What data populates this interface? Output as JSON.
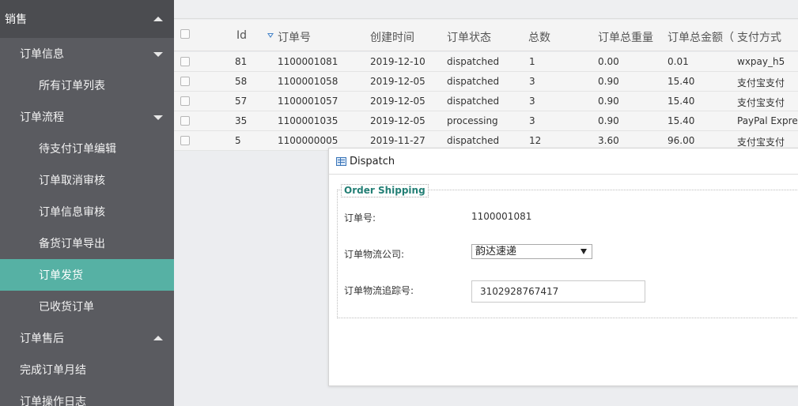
{
  "sidebar": {
    "section": "销售",
    "items": [
      {
        "label": "订单信息",
        "level": 1,
        "caret": "down"
      },
      {
        "label": "所有订单列表",
        "level": 2
      },
      {
        "label": "订单流程",
        "level": 1,
        "caret": "down"
      },
      {
        "label": "待支付订单编辑",
        "level": 2
      },
      {
        "label": "订单取消审核",
        "level": 2
      },
      {
        "label": "订单信息审核",
        "level": 2
      },
      {
        "label": "备货订单导出",
        "level": 2
      },
      {
        "label": "订单发货",
        "level": 2,
        "active": true
      },
      {
        "label": "已收货订单",
        "level": 2
      },
      {
        "label": "订单售后",
        "level": 1,
        "caret": "up"
      },
      {
        "label": "完成订单月结",
        "level": 1
      },
      {
        "label": "订单操作日志",
        "level": 1
      }
    ]
  },
  "table": {
    "headers": {
      "id": "Id",
      "order_no": "订单号",
      "created": "创建时间",
      "status": "订单状态",
      "total": "总数",
      "weight": "订单总重量",
      "amount": "订单总金额（",
      "payment": "支付方式"
    },
    "rows": [
      {
        "id": "81",
        "order_no": "1100001081",
        "created": "2019-12-10",
        "status": "dispatched",
        "total": "1",
        "weight": "0.00",
        "amount": "0.01",
        "payment": "wxpay_h5"
      },
      {
        "id": "58",
        "order_no": "1100001058",
        "created": "2019-12-05",
        "status": "dispatched",
        "total": "3",
        "weight": "0.90",
        "amount": "15.40",
        "payment": "支付宝支付"
      },
      {
        "id": "57",
        "order_no": "1100001057",
        "created": "2019-12-05",
        "status": "dispatched",
        "total": "3",
        "weight": "0.90",
        "amount": "15.40",
        "payment": "支付宝支付"
      },
      {
        "id": "35",
        "order_no": "1100001035",
        "created": "2019-12-05",
        "status": "processing",
        "total": "3",
        "weight": "0.90",
        "amount": "15.40",
        "payment": "PayPal Express"
      },
      {
        "id": "5",
        "order_no": "1100000005",
        "created": "2019-11-27",
        "status": "dispatched",
        "total": "12",
        "weight": "3.60",
        "amount": "96.00",
        "payment": "支付宝支付"
      }
    ]
  },
  "dialog": {
    "title": "Dispatch",
    "legend": "Order Shipping",
    "order_no_label": "订单号:",
    "order_no_value": "1100001081",
    "carrier_label": "订单物流公司:",
    "carrier_value": "韵达速递",
    "tracking_label": "订单物流追踪号:",
    "tracking_value": "3102928767417"
  },
  "colors": {
    "sidebar_bg": "#5a5b60",
    "sidebar_active": "#56b1a4",
    "legend_text": "#237f75"
  }
}
